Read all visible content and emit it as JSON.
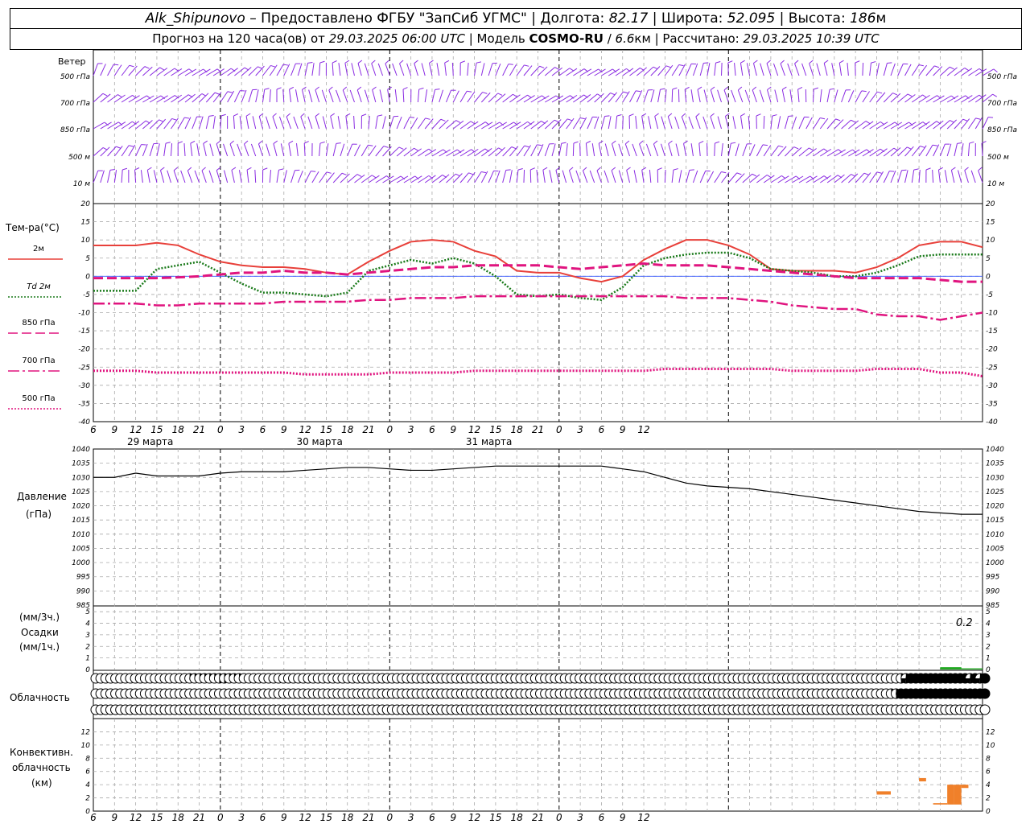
{
  "header": {
    "station": "Alk_Shipunovo",
    "provider": " – Предоставлено ФГБУ \"ЗапСиб УГМС\" | ",
    "lon_label": "Долгота: ",
    "lon": "82.17",
    "lat_label": " | Широта: ",
    "lat": "52.095",
    "alt_label": " | Высота: ",
    "alt": "186",
    "alt_unit": "м",
    "forecast_prefix": "Прогноз на 120 часа(ов) от ",
    "forecast_from": "29.03.2025 06:00 UTC",
    "model_label": "  | Модель ",
    "model": "COSMO-RU",
    "model_sep": " / ",
    "resolution": "6.6",
    "res_unit": "км",
    "calc_label": " | Рассчитано: ",
    "calc_time": "29.03.2025 10:39 UTC"
  },
  "wind_panel": {
    "title": "Ветер",
    "levels": [
      "500 гПа",
      "700 гПа",
      "850 гПа",
      "500 м",
      "10  м"
    ],
    "color": "#8a2be2"
  },
  "temp_panel": {
    "title": "Тем-ра(°C)",
    "legend": [
      {
        "label": "2м",
        "color": "#e8403a",
        "style": "solid"
      },
      {
        "label": "Td  2м",
        "color": "#1a7a1a",
        "style": "dotted"
      },
      {
        "label": "850 гПа",
        "color": "#e0147f",
        "style": "dash"
      },
      {
        "label": "700 гПа",
        "color": "#e0147f",
        "style": "dashdot"
      },
      {
        "label": "500 гПа",
        "color": "#e0147f",
        "style": "dot"
      }
    ],
    "yticks": [
      "20",
      "15",
      "10",
      "5",
      "0",
      "-5",
      "-10",
      "-15",
      "-20",
      "-25",
      "-30",
      "-35",
      "-40"
    ]
  },
  "xaxis": {
    "hour_labels": [
      "6",
      "9",
      "12",
      "15",
      "18",
      "21",
      "0",
      "3",
      "6",
      "9",
      "12",
      "15",
      "18",
      "21",
      "0",
      "3",
      "6",
      "9",
      "12",
      "15",
      "18",
      "21",
      "0",
      "3",
      "6",
      "9",
      "12"
    ],
    "dates": [
      "29 марта",
      "30 марта",
      "31 марта"
    ]
  },
  "pressure_panel": {
    "title1": "Давление",
    "title2": "(гПа)",
    "yticks": [
      "1040",
      "1035",
      "1030",
      "1025",
      "1020",
      "1015",
      "1010",
      "1005",
      "1000",
      "995",
      "990",
      "985"
    ]
  },
  "precip_panel": {
    "title1": "(мм/3ч.)",
    "title2": "Осадки",
    "title3": "(мм/1ч.)",
    "yticks": [
      "5",
      "4",
      "3",
      "2",
      "1",
      "0"
    ],
    "max_label": "0.2",
    "bar_color": "#22aa22"
  },
  "cloud_panel": {
    "title": "Облачность"
  },
  "conv_panel": {
    "title1": "Конвективн.",
    "title2": "облачность",
    "title3": "(км)",
    "yticks": [
      "12",
      "10",
      "8",
      "6",
      "4",
      "2",
      "0"
    ],
    "bar_color": "#f0802a"
  },
  "chart_data": [
    {
      "type": "line",
      "title": "Тем-ра(°C)",
      "x_hours": [
        0,
        6,
        9,
        12,
        15,
        18,
        21,
        24,
        27,
        30,
        33,
        36,
        39,
        42,
        45,
        48,
        51,
        54,
        57,
        60,
        63,
        66,
        69,
        72,
        75,
        78,
        81,
        84,
        87,
        90,
        93,
        96,
        99,
        102,
        105,
        108,
        111,
        114,
        117,
        120,
        123,
        126
      ],
      "ylim": [
        -40,
        20
      ],
      "series": [
        {
          "name": "2м",
          "values": [
            8.5,
            8.5,
            9.2,
            8.5,
            6,
            4,
            3,
            2.5,
            2.5,
            2,
            1,
            0.5,
            4,
            7,
            9.5,
            10,
            9.5,
            7,
            5.5,
            1.5,
            1,
            1,
            -0.5,
            -1.5,
            0,
            4.5,
            7.5,
            10,
            10,
            8.5,
            6,
            2,
            1.5,
            1.5,
            1.5,
            1,
            2.5,
            5,
            8.5,
            9.5,
            9.5,
            8
          ]
        },
        {
          "name": "Td  2м",
          "values": [
            -4,
            -4,
            2,
            3,
            4,
            1,
            -2,
            -4.5,
            -4.5,
            -5,
            -5.5,
            -4.5,
            1.5,
            3,
            4.5,
            3.5,
            5,
            3.5,
            0,
            -5,
            -5.5,
            -5,
            -6,
            -6.5,
            -3,
            3,
            5,
            6,
            6.5,
            6.5,
            5,
            2,
            1.5,
            1,
            0,
            0,
            1,
            3,
            5.5,
            6,
            6,
            6
          ]
        },
        {
          "name": "850 гПа",
          "values": [
            -0.5,
            -0.5,
            -0.5,
            -0.3,
            0,
            0.5,
            1,
            1,
            1.5,
            1,
            1,
            0.5,
            1,
            1.5,
            2,
            2.5,
            2.5,
            3,
            3,
            3,
            3,
            2.5,
            2,
            2.5,
            3,
            3.5,
            3,
            3,
            3,
            2.5,
            2,
            1.5,
            1,
            0.5,
            0,
            -0.5,
            -0.5,
            -0.5,
            -0.5,
            -1,
            -1.5,
            -1.5
          ]
        },
        {
          "name": "700 гПа",
          "values": [
            -7.5,
            -7.5,
            -8,
            -8,
            -7.5,
            -7.5,
            -7.5,
            -7.5,
            -7,
            -7,
            -7,
            -7,
            -6.5,
            -6.5,
            -6,
            -6,
            -6,
            -5.5,
            -5.5,
            -5.5,
            -5.5,
            -5.5,
            -5.5,
            -5.5,
            -5.5,
            -5.5,
            -5.5,
            -6,
            -6,
            -6,
            -6.5,
            -7,
            -8,
            -8.5,
            -9,
            -9,
            -10.5,
            -11,
            -11,
            -12,
            -11,
            -10
          ]
        },
        {
          "name": "500 гПа",
          "values": [
            -26,
            -26,
            -26.5,
            -26.5,
            -26.5,
            -26.5,
            -26.5,
            -26.5,
            -26.5,
            -27,
            -27,
            -27,
            -27,
            -26.5,
            -26.5,
            -26.5,
            -26.5,
            -26,
            -26,
            -26,
            -26,
            -26,
            -26,
            -26,
            -26,
            -26,
            -25.5,
            -25.5,
            -25.5,
            -25.5,
            -25.5,
            -25.5,
            -26,
            -26,
            -26,
            -26,
            -25.5,
            -25.5,
            -25.5,
            -26.5,
            -26.5,
            -27.5
          ]
        }
      ]
    },
    {
      "type": "line",
      "title": "Давление (гПа)",
      "x_hours": [
        0,
        3,
        6,
        9,
        12,
        15,
        18,
        21,
        24,
        27,
        30,
        33,
        36,
        39,
        42,
        45,
        48,
        51,
        54,
        57,
        60,
        63,
        66,
        69,
        72,
        75,
        78,
        81,
        84,
        87,
        90,
        93,
        96,
        99,
        102,
        105,
        108,
        111,
        114,
        117,
        120,
        123,
        126
      ],
      "ylim": [
        985,
        1040
      ],
      "series": [
        {
          "name": "p",
          "values": [
            1030,
            1030,
            1031.5,
            1030.5,
            1030.5,
            1030.5,
            1031.5,
            1032,
            1032,
            1032,
            1032.5,
            1033,
            1033.5,
            1033.5,
            1033,
            1032.5,
            1032.5,
            1033,
            1033.5,
            1034,
            1034,
            1034,
            1034,
            1034,
            1034,
            1033,
            1032,
            1030,
            1028,
            1027,
            1026.5,
            1026,
            1025,
            1024,
            1023,
            1022,
            1021,
            1020,
            1019,
            1018,
            1017.5,
            1017,
            1017
          ]
        }
      ]
    },
    {
      "type": "bar",
      "title": "Осадки",
      "x_hours": [
        120,
        123,
        126
      ],
      "ylim": [
        0,
        5.5
      ],
      "values": [
        0.2,
        0.1,
        0
      ]
    },
    {
      "type": "table",
      "title": "Облачность",
      "note": "cloud cover per hour (0=clear, 4=overcast), 3 layers",
      "hours_start": 0,
      "rows": [
        [
          0,
          0,
          0,
          0,
          0,
          0,
          0,
          0,
          0,
          0,
          0,
          0,
          0,
          0,
          0,
          0,
          0,
          0,
          0,
          1,
          1,
          1,
          1,
          1,
          1,
          2,
          2,
          1,
          1,
          1,
          0,
          0,
          0,
          0,
          0,
          0,
          0,
          0,
          0,
          0,
          0,
          0,
          0,
          0,
          0,
          0,
          0,
          0,
          0,
          0,
          0,
          0,
          0,
          0,
          0,
          0,
          0,
          0,
          0,
          0,
          0,
          0,
          0,
          0,
          0,
          0,
          0,
          0,
          0,
          0,
          0,
          0,
          0,
          0,
          0,
          0,
          0,
          0,
          0,
          0,
          0,
          0,
          0,
          0,
          0,
          0,
          0,
          0,
          0,
          0,
          0,
          0,
          0,
          0,
          0,
          0,
          0,
          0,
          0,
          0,
          0,
          0,
          0,
          0,
          0,
          0,
          0,
          0,
          0,
          0,
          0,
          0,
          0,
          0,
          0,
          0,
          0,
          0,
          0,
          0,
          0,
          0,
          0,
          0,
          0,
          0,
          0,
          0,
          0,
          0,
          0,
          0,
          0,
          0,
          0,
          0,
          0,
          0,
          0,
          0,
          0,
          0,
          0,
          0,
          0,
          0,
          0,
          0,
          0,
          0,
          0,
          0,
          0,
          0,
          0,
          0,
          0,
          0,
          0,
          0,
          0,
          0,
          0,
          2,
          3,
          4,
          4,
          4,
          4,
          4,
          4,
          4,
          4,
          4,
          4,
          4,
          4,
          3,
          4,
          3,
          4,
          2,
          4,
          4
        ],
        [
          0,
          0,
          0,
          0,
          0,
          0,
          0,
          0,
          0,
          0,
          0,
          0,
          0,
          0,
          0,
          0,
          0,
          0,
          0,
          0,
          0,
          0,
          0,
          0,
          0,
          0,
          0,
          0,
          0,
          0,
          0,
          0,
          0,
          0,
          0,
          0,
          0,
          0,
          0,
          0,
          0,
          0,
          0,
          0,
          0,
          0,
          0,
          0,
          0,
          0,
          0,
          0,
          0,
          0,
          0,
          0,
          0,
          0,
          0,
          0,
          0,
          0,
          0,
          0,
          0,
          0,
          0,
          0,
          0,
          0,
          0,
          0,
          0,
          0,
          0,
          0,
          0,
          0,
          0,
          0,
          0,
          0,
          0,
          0,
          0,
          0,
          0,
          0,
          0,
          0,
          0,
          0,
          0,
          0,
          0,
          0,
          0,
          0,
          0,
          0,
          0,
          0,
          0,
          0,
          0,
          0,
          0,
          0,
          0,
          0,
          0,
          0,
          0,
          0,
          0,
          0,
          0,
          0,
          0,
          0,
          0,
          0,
          0,
          0,
          0,
          0,
          0,
          0,
          0,
          0,
          0,
          0,
          0,
          0,
          0,
          0,
          0,
          0,
          0,
          0,
          0,
          0,
          0,
          0,
          0,
          0,
          0,
          0,
          0,
          0,
          0,
          0,
          0,
          0,
          0,
          0,
          0,
          0,
          0,
          0,
          0,
          1,
          2,
          4,
          4,
          4,
          4,
          4,
          4,
          4,
          4,
          4,
          4,
          4,
          4,
          4,
          4,
          4,
          4,
          4,
          4,
          4,
          4,
          4
        ],
        [
          0,
          0,
          0,
          0,
          0,
          0,
          0,
          0,
          0,
          0,
          0,
          0,
          0,
          0,
          0,
          0,
          0,
          0,
          0,
          0,
          0,
          0,
          0,
          0,
          0,
          0,
          0,
          0,
          0,
          0,
          0,
          0,
          0,
          0,
          0,
          0,
          0,
          0,
          0,
          0,
          0,
          0,
          0,
          0,
          0,
          0,
          0,
          0,
          0,
          0,
          0,
          0,
          0,
          0,
          0,
          0,
          0,
          0,
          0,
          0,
          0,
          0,
          0,
          0,
          0,
          0,
          0,
          0,
          0,
          0,
          0,
          0,
          0,
          0,
          0,
          0,
          0,
          0,
          0,
          0,
          0,
          0,
          0,
          0,
          0,
          0,
          0,
          0,
          0,
          0,
          0,
          0,
          0,
          0,
          0,
          0,
          0,
          0,
          0,
          0,
          0,
          0,
          0,
          0,
          0,
          0,
          0,
          0,
          0,
          0,
          0,
          0,
          0,
          0,
          0,
          0,
          0,
          0,
          0,
          0,
          0,
          0,
          0,
          0,
          0,
          0,
          0,
          0,
          0,
          0,
          0,
          0,
          0,
          0,
          0,
          0,
          0,
          0,
          0,
          0,
          0,
          0,
          0,
          0,
          0,
          0,
          0,
          0,
          0,
          0,
          0,
          0,
          0,
          0,
          0,
          0,
          0,
          0,
          0,
          0,
          0,
          0,
          0,
          0,
          0,
          0,
          0,
          0,
          0,
          0,
          0,
          0,
          0,
          0,
          0,
          0,
          0,
          0,
          0,
          0,
          0,
          0,
          0,
          0,
          0,
          0,
          0,
          0,
          0,
          0,
          0,
          0,
          0,
          0,
          4,
          4,
          4,
          4
        ]
      ]
    },
    {
      "type": "bar",
      "title": "Конвективн. облачность (км)",
      "ylim": [
        0,
        14
      ],
      "bars": [
        {
          "h_from": 111,
          "h_to": 113,
          "base": 2.5,
          "top": 3
        },
        {
          "h_from": 117,
          "h_to": 118,
          "base": 4.5,
          "top": 5
        },
        {
          "h_from": 119,
          "h_to": 121,
          "base": 1,
          "top": 1.2
        },
        {
          "h_from": 121,
          "h_to": 122,
          "base": 1,
          "top": 4
        },
        {
          "h_from": 122,
          "h_to": 123,
          "base": 1,
          "top": 4
        },
        {
          "h_from": 123,
          "h_to": 124,
          "base": 3.5,
          "top": 4
        }
      ]
    }
  ]
}
